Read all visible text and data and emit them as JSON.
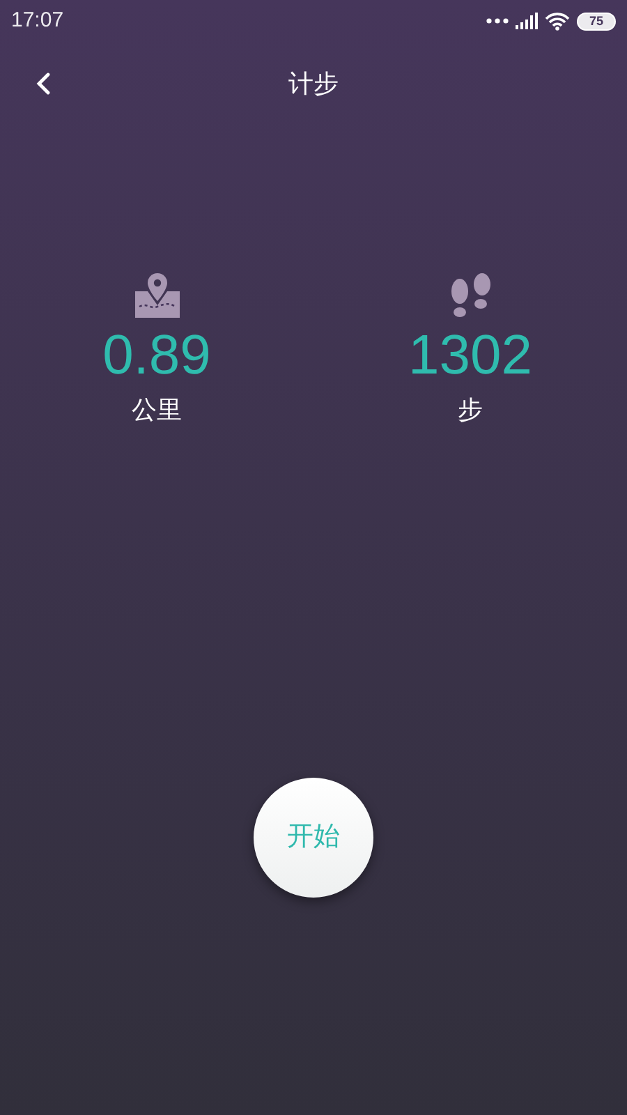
{
  "status_bar": {
    "time": "17:07",
    "battery": "75"
  },
  "header": {
    "title": "计步"
  },
  "stats": [
    {
      "kind": "distance",
      "value": "0.89",
      "unit": "公里"
    },
    {
      "kind": "steps",
      "value": "1302",
      "unit": "步"
    }
  ],
  "start_button": {
    "label": "开始"
  }
}
